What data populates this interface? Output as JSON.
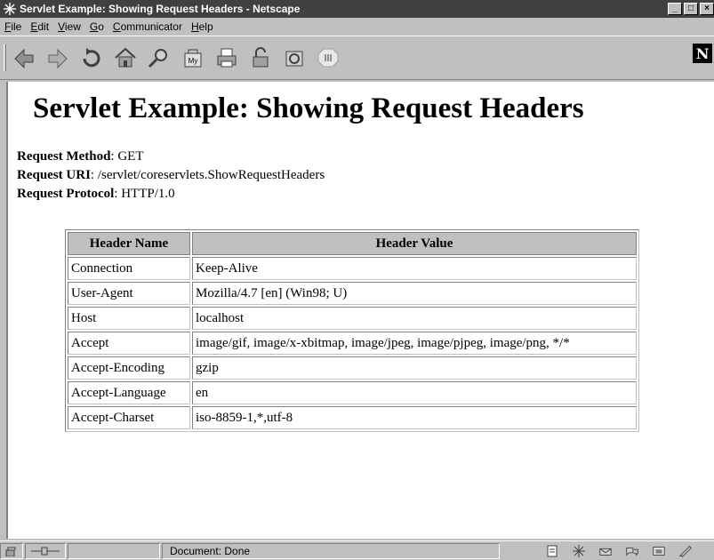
{
  "window": {
    "title": "Servlet Example: Showing Request Headers - Netscape",
    "buttons": {
      "minimize": "_",
      "maximize": "□",
      "close": "×"
    }
  },
  "menubar": [
    {
      "ul": "F",
      "rest": "ile"
    },
    {
      "ul": "E",
      "rest": "dit"
    },
    {
      "ul": "V",
      "rest": "iew"
    },
    {
      "ul": "G",
      "rest": "o"
    },
    {
      "ul": "C",
      "rest": "ommunicator"
    },
    {
      "ul": "H",
      "rest": "elp"
    }
  ],
  "toolbar": {
    "icons": [
      "back-icon",
      "forward-icon",
      "reload-icon",
      "home-icon",
      "search-icon",
      "my-netscape-icon",
      "print-icon",
      "security-icon",
      "shop-icon",
      "stop-icon"
    ],
    "logo": "N"
  },
  "page": {
    "heading": "Servlet Example: Showing Request Headers",
    "method": {
      "label": "Request Method",
      "value": ": GET"
    },
    "uri": {
      "label": "Request URI",
      "value": ": /servlet/coreservlets.ShowRequestHeaders"
    },
    "protocol": {
      "label": "Request Protocol",
      "value": ": HTTP/1.0"
    }
  },
  "table": {
    "columns": [
      "Header Name",
      "Header Value"
    ],
    "rows": [
      [
        "Connection",
        "Keep-Alive"
      ],
      [
        "User-Agent",
        "Mozilla/4.7 [en] (Win98; U)"
      ],
      [
        "Host",
        "localhost"
      ],
      [
        "Accept",
        "image/gif, image/x-xbitmap, image/jpeg, image/pjpeg, image/png, */*"
      ],
      [
        "Accept-Encoding",
        "gzip"
      ],
      [
        "Accept-Language",
        "en"
      ],
      [
        "Accept-Charset",
        "iso-8859-1,*,utf-8"
      ]
    ]
  },
  "statusbar": {
    "text": "Document: Done"
  }
}
